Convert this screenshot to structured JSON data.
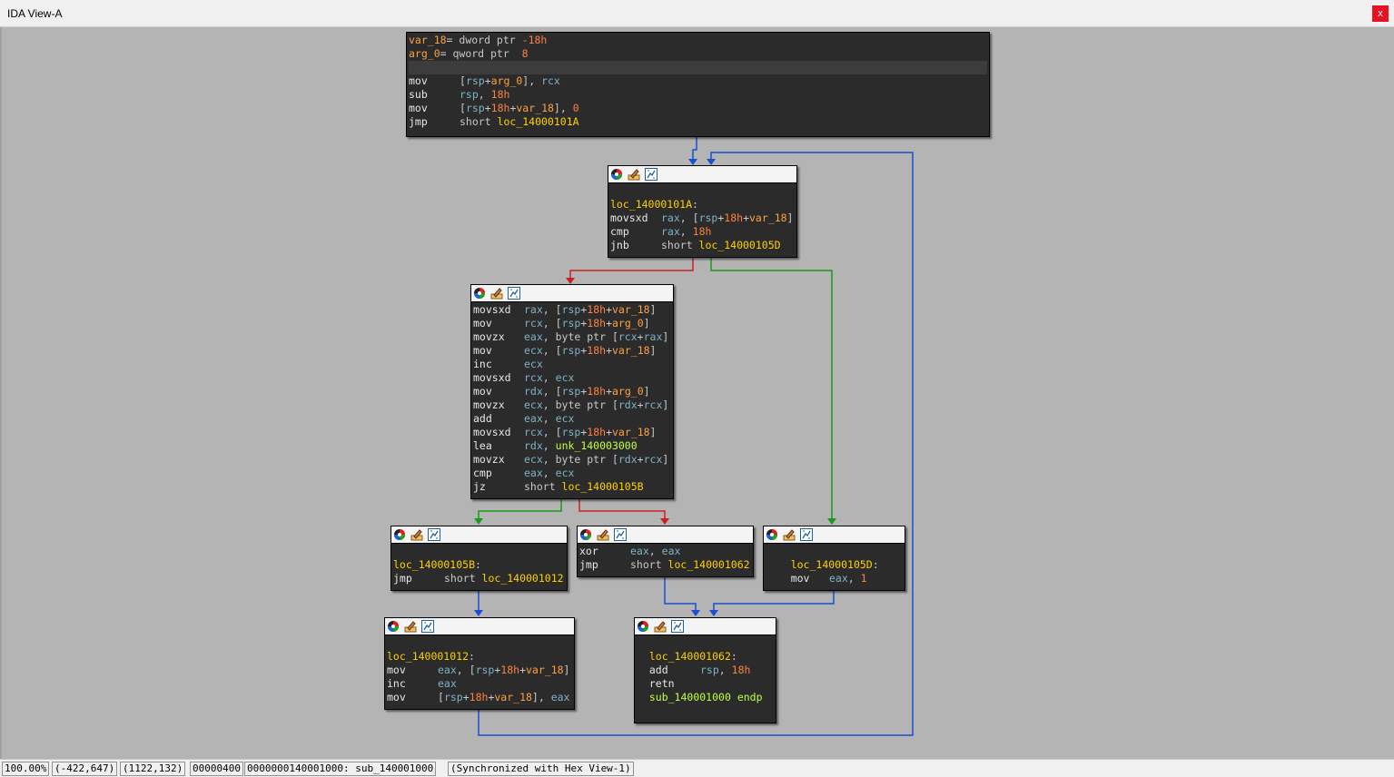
{
  "window": {
    "title": "IDA View-A",
    "close_label": "x"
  },
  "colors": {
    "true_edge": "#1a9a1a",
    "false_edge": "#cc2020",
    "jump_edge": "#1a4fd0"
  },
  "header_icons": [
    "color-palette-icon",
    "edit-title-icon",
    "graph-icon"
  ],
  "nodes": {
    "entry": {
      "lines": [
        {
          "segs": [
            [
              "var",
              "var_18"
            ],
            [
              "tk",
              "= dword ptr "
            ],
            [
              "num",
              "-18h"
            ]
          ]
        },
        {
          "segs": [
            [
              "var",
              "arg_0"
            ],
            [
              "tk",
              "= qword ptr  "
            ],
            [
              "num",
              "8"
            ]
          ]
        },
        {
          "segs": []
        },
        {
          "mn": "mov",
          "segs": [
            [
              "tk",
              "["
            ],
            [
              "reg",
              "rsp"
            ],
            [
              "tk",
              "+"
            ],
            [
              "var",
              "arg_0"
            ],
            [
              "tk",
              "], "
            ],
            [
              "reg",
              "rcx"
            ]
          ]
        },
        {
          "mn": "sub",
          "segs": [
            [
              "reg",
              "rsp"
            ],
            [
              "tk",
              ", "
            ],
            [
              "num",
              "18h"
            ]
          ]
        },
        {
          "mn": "mov",
          "segs": [
            [
              "tk",
              "["
            ],
            [
              "reg",
              "rsp"
            ],
            [
              "tk",
              "+"
            ],
            [
              "num",
              "18h"
            ],
            [
              "tk",
              "+"
            ],
            [
              "var",
              "var_18"
            ],
            [
              "tk",
              "], "
            ],
            [
              "num",
              "0"
            ]
          ]
        },
        {
          "mn": "jmp",
          "segs": [
            [
              "tk",
              "short "
            ],
            [
              "lbl",
              "loc_14000101A"
            ]
          ]
        }
      ]
    },
    "loop_head": {
      "lines": [
        {
          "segs": []
        },
        {
          "segs": [
            [
              "lbl",
              "loc_14000101A"
            ],
            [
              "tk",
              ":"
            ]
          ]
        },
        {
          "mn": "movsxd",
          "segs": [
            [
              "reg",
              "rax"
            ],
            [
              "tk",
              ", ["
            ],
            [
              "reg",
              "rsp"
            ],
            [
              "tk",
              "+"
            ],
            [
              "num",
              "18h"
            ],
            [
              "tk",
              "+"
            ],
            [
              "var",
              "var_18"
            ],
            [
              "tk",
              "]"
            ]
          ]
        },
        {
          "mn": "cmp",
          "segs": [
            [
              "reg",
              "rax"
            ],
            [
              "tk",
              ", "
            ],
            [
              "num",
              "18h"
            ]
          ]
        },
        {
          "mn": "jnb",
          "segs": [
            [
              "tk",
              "short "
            ],
            [
              "lbl",
              "loc_14000105D"
            ]
          ]
        }
      ]
    },
    "loop_body": {
      "lines": [
        {
          "mn": "movsxd",
          "segs": [
            [
              "reg",
              "rax"
            ],
            [
              "tk",
              ", ["
            ],
            [
              "reg",
              "rsp"
            ],
            [
              "tk",
              "+"
            ],
            [
              "num",
              "18h"
            ],
            [
              "tk",
              "+"
            ],
            [
              "var",
              "var_18"
            ],
            [
              "tk",
              "]"
            ]
          ]
        },
        {
          "mn": "mov",
          "segs": [
            [
              "reg",
              "rcx"
            ],
            [
              "tk",
              ", ["
            ],
            [
              "reg",
              "rsp"
            ],
            [
              "tk",
              "+"
            ],
            [
              "num",
              "18h"
            ],
            [
              "tk",
              "+"
            ],
            [
              "var",
              "arg_0"
            ],
            [
              "tk",
              "]"
            ]
          ]
        },
        {
          "mn": "movzx",
          "segs": [
            [
              "reg",
              "eax"
            ],
            [
              "tk",
              ", byte ptr ["
            ],
            [
              "reg",
              "rcx"
            ],
            [
              "tk",
              "+"
            ],
            [
              "reg",
              "rax"
            ],
            [
              "tk",
              "]"
            ]
          ]
        },
        {
          "mn": "mov",
          "segs": [
            [
              "reg",
              "ecx"
            ],
            [
              "tk",
              ", ["
            ],
            [
              "reg",
              "rsp"
            ],
            [
              "tk",
              "+"
            ],
            [
              "num",
              "18h"
            ],
            [
              "tk",
              "+"
            ],
            [
              "var",
              "var_18"
            ],
            [
              "tk",
              "]"
            ]
          ]
        },
        {
          "mn": "inc",
          "segs": [
            [
              "reg",
              "ecx"
            ]
          ]
        },
        {
          "mn": "movsxd",
          "segs": [
            [
              "reg",
              "rcx"
            ],
            [
              "tk",
              ", "
            ],
            [
              "reg",
              "ecx"
            ]
          ]
        },
        {
          "mn": "mov",
          "segs": [
            [
              "reg",
              "rdx"
            ],
            [
              "tk",
              ", ["
            ],
            [
              "reg",
              "rsp"
            ],
            [
              "tk",
              "+"
            ],
            [
              "num",
              "18h"
            ],
            [
              "tk",
              "+"
            ],
            [
              "var",
              "arg_0"
            ],
            [
              "tk",
              "]"
            ]
          ]
        },
        {
          "mn": "movzx",
          "segs": [
            [
              "reg",
              "ecx"
            ],
            [
              "tk",
              ", byte ptr ["
            ],
            [
              "reg",
              "rdx"
            ],
            [
              "tk",
              "+"
            ],
            [
              "reg",
              "rcx"
            ],
            [
              "tk",
              "]"
            ]
          ]
        },
        {
          "mn": "add",
          "segs": [
            [
              "reg",
              "eax"
            ],
            [
              "tk",
              ", "
            ],
            [
              "reg",
              "ecx"
            ]
          ]
        },
        {
          "mn": "movsxd",
          "segs": [
            [
              "reg",
              "rcx"
            ],
            [
              "tk",
              ", ["
            ],
            [
              "reg",
              "rsp"
            ],
            [
              "tk",
              "+"
            ],
            [
              "num",
              "18h"
            ],
            [
              "tk",
              "+"
            ],
            [
              "var",
              "var_18"
            ],
            [
              "tk",
              "]"
            ]
          ]
        },
        {
          "mn": "lea",
          "segs": [
            [
              "reg",
              "rdx"
            ],
            [
              "tk",
              ", "
            ],
            [
              "unk",
              "unk_140003000"
            ]
          ]
        },
        {
          "mn": "movzx",
          "segs": [
            [
              "reg",
              "ecx"
            ],
            [
              "tk",
              ", byte ptr ["
            ],
            [
              "reg",
              "rdx"
            ],
            [
              "tk",
              "+"
            ],
            [
              "reg",
              "rcx"
            ],
            [
              "tk",
              "]"
            ]
          ]
        },
        {
          "mn": "cmp",
          "segs": [
            [
              "reg",
              "eax"
            ],
            [
              "tk",
              ", "
            ],
            [
              "reg",
              "ecx"
            ]
          ]
        },
        {
          "mn": "jz",
          "segs": [
            [
              "tk",
              "short "
            ],
            [
              "lbl",
              "loc_14000105B"
            ]
          ]
        }
      ]
    },
    "n105b": {
      "lines": [
        {
          "segs": []
        },
        {
          "segs": [
            [
              "lbl",
              "loc_14000105B"
            ],
            [
              "tk",
              ":"
            ]
          ]
        },
        {
          "mn": "jmp",
          "segs": [
            [
              "tk",
              "short "
            ],
            [
              "lbl",
              "loc_140001012"
            ]
          ]
        }
      ]
    },
    "fail": {
      "lines": [
        {
          "mn": "xor",
          "segs": [
            [
              "reg",
              "eax"
            ],
            [
              "tk",
              ", "
            ],
            [
              "reg",
              "eax"
            ]
          ]
        },
        {
          "mn": "jmp",
          "segs": [
            [
              "tk",
              "short "
            ],
            [
              "lbl",
              "loc_140001062"
            ]
          ]
        }
      ]
    },
    "n105d": {
      "lines": [
        {
          "segs": []
        },
        {
          "segs": [
            [
              "tk",
              "    "
            ],
            [
              "lbl",
              "loc_14000105D"
            ],
            [
              "tk",
              ":"
            ]
          ]
        },
        {
          "mn": "    mov",
          "segs": [
            [
              "reg",
              "eax"
            ],
            [
              "tk",
              ", "
            ],
            [
              "num",
              "1"
            ]
          ]
        }
      ]
    },
    "n1012": {
      "lines": [
        {
          "segs": []
        },
        {
          "segs": [
            [
              "lbl",
              "loc_140001012"
            ],
            [
              "tk",
              ":"
            ]
          ]
        },
        {
          "mn": "mov",
          "segs": [
            [
              "reg",
              "eax"
            ],
            [
              "tk",
              ", ["
            ],
            [
              "reg",
              "rsp"
            ],
            [
              "tk",
              "+"
            ],
            [
              "num",
              "18h"
            ],
            [
              "tk",
              "+"
            ],
            [
              "var",
              "var_18"
            ],
            [
              "tk",
              "]"
            ]
          ]
        },
        {
          "mn": "inc",
          "segs": [
            [
              "reg",
              "eax"
            ]
          ]
        },
        {
          "mn": "mov",
          "segs": [
            [
              "tk",
              "["
            ],
            [
              "reg",
              "rsp"
            ],
            [
              "tk",
              "+"
            ],
            [
              "num",
              "18h"
            ],
            [
              "tk",
              "+"
            ],
            [
              "var",
              "var_18"
            ],
            [
              "tk",
              "], "
            ],
            [
              "reg",
              "eax"
            ]
          ]
        }
      ]
    },
    "n1062": {
      "lines": [
        {
          "segs": []
        },
        {
          "segs": [
            [
              "tk",
              "  "
            ],
            [
              "lbl",
              "loc_140001062"
            ],
            [
              "tk",
              ":"
            ]
          ]
        },
        {
          "mn": "  add",
          "segs": [
            [
              "reg",
              "rsp"
            ],
            [
              "tk",
              ", "
            ],
            [
              "num",
              "18h"
            ]
          ]
        },
        {
          "mn": "  retn",
          "segs": []
        },
        {
          "segs": [
            [
              "tk",
              "  "
            ],
            [
              "unk",
              "sub_140001000"
            ],
            [
              "tk",
              " "
            ],
            [
              "unk",
              "endp"
            ]
          ]
        },
        {
          "segs": []
        }
      ]
    }
  },
  "status": {
    "zoom": "100.00%",
    "mouse_pos": "(-422,647)",
    "graph_pos": "(1122,132)",
    "file_offset": "00000400",
    "address": "0000000140001000: sub_140001000",
    "sync": "(Synchronized with Hex View-1)"
  }
}
